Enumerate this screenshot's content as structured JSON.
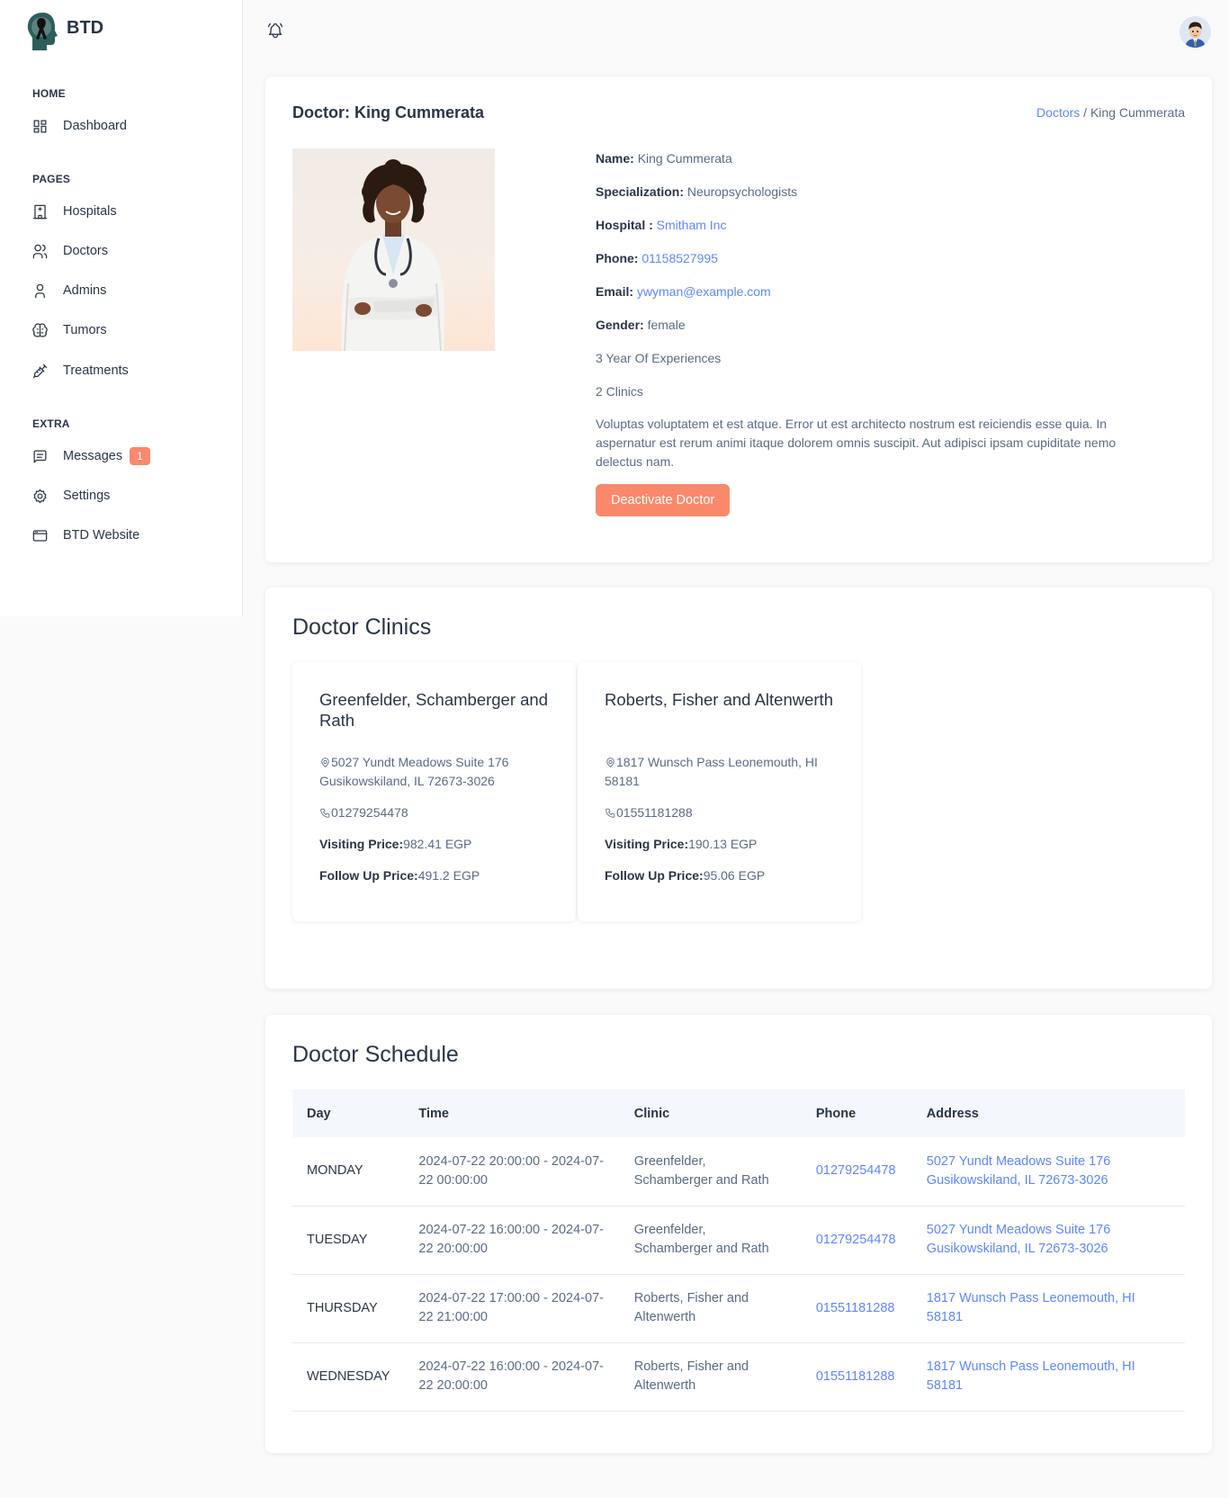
{
  "brand": {
    "name": "BTD"
  },
  "sidebar": {
    "sections": [
      {
        "title": "HOME"
      },
      {
        "title": "PAGES"
      },
      {
        "title": "EXTRA"
      }
    ],
    "items": [
      {
        "label": "Dashboard",
        "icon": "dashboard-icon"
      },
      {
        "label": "Hospitals",
        "icon": "hospital-icon"
      },
      {
        "label": "Doctors",
        "icon": "users-icon"
      },
      {
        "label": "Admins",
        "icon": "user-icon"
      },
      {
        "label": "Tumors",
        "icon": "brain-icon"
      },
      {
        "label": "Treatments",
        "icon": "vaccine-icon"
      },
      {
        "label": "Messages",
        "icon": "message-icon",
        "badge": "1"
      },
      {
        "label": "Settings",
        "icon": "settings-icon"
      },
      {
        "label": "BTD Website",
        "icon": "browser-icon"
      }
    ]
  },
  "doctor": {
    "title": "Doctor: King Cummerata",
    "breadcrumb": {
      "link": "Doctors",
      "separator": " / ",
      "current": "King Cummerata"
    },
    "name_label": "Name:",
    "name": "King Cummerata",
    "specialization_label": "Specialization:",
    "specialization": "Neuropsychologists",
    "hospital_label": "Hospital :",
    "hospital": "Smitham Inc",
    "phone_label": "Phone:",
    "phone": "01158527995",
    "email_label": "Email:",
    "email": "ywyman@example.com",
    "gender_label": "Gender:",
    "gender": "female",
    "experience": "3 Year Of Experiences",
    "clinics_count": "2 Clinics",
    "bio": "Voluptas voluptatem et est atque. Error ut est architecto nostrum est reiciendis esse quia. In aspernatur est rerum animi itaque dolorem omnis suscipit. Aut adipisci ipsam cupiditate nemo delectus nam.",
    "deactivate_label": "Deactivate Doctor"
  },
  "clinics": {
    "title": "Doctor Clinics",
    "visiting_label": "Visiting Price:",
    "followup_label": "Follow Up Price:",
    "items": [
      {
        "name": "Greenfelder, Schamberger and Rath",
        "address": "5027 Yundt Meadows Suite 176 Gusikowskiland, IL 72673-3026",
        "phone": "01279254478",
        "visiting_price": "982.41 EGP",
        "followup_price": "491.2 EGP"
      },
      {
        "name": "Roberts, Fisher and Altenwerth",
        "address": "1817 Wunsch Pass Leonemouth, HI 58181",
        "phone": "01551181288",
        "visiting_price": "190.13 EGP",
        "followup_price": "95.06 EGP"
      }
    ]
  },
  "schedule": {
    "title": "Doctor Schedule",
    "columns": [
      "Day",
      "Time",
      "Clinic",
      "Phone",
      "Address"
    ],
    "rows": [
      {
        "day": "MONDAY",
        "time": "2024-07-22 20:00:00 - 2024-07-22 00:00:00",
        "clinic": "Greenfelder, Schamberger and Rath",
        "phone": "01279254478",
        "address": "5027 Yundt Meadows Suite 176 Gusikowskiland, IL 72673-3026"
      },
      {
        "day": "TUESDAY",
        "time": "2024-07-22 16:00:00 - 2024-07-22 20:00:00",
        "clinic": "Greenfelder, Schamberger and Rath",
        "phone": "01279254478",
        "address": "5027 Yundt Meadows Suite 176 Gusikowskiland, IL 72673-3026"
      },
      {
        "day": "THURSDAY",
        "time": "2024-07-22 17:00:00 - 2024-07-22 21:00:00",
        "clinic": "Roberts, Fisher and Altenwerth",
        "phone": "01551181288",
        "address": "1817 Wunsch Pass Leonemouth, HI 58181"
      },
      {
        "day": "WEDNESDAY",
        "time": "2024-07-22 16:00:00 - 2024-07-22 20:00:00",
        "clinic": "Roberts, Fisher and Altenwerth",
        "phone": "01551181288",
        "address": "1817 Wunsch Pass Leonemouth, HI 58181"
      }
    ]
  },
  "colors": {
    "accent": "#5d87ff",
    "danger": "#fa896b",
    "text": "#2a3547",
    "muted": "#5a6a85"
  }
}
